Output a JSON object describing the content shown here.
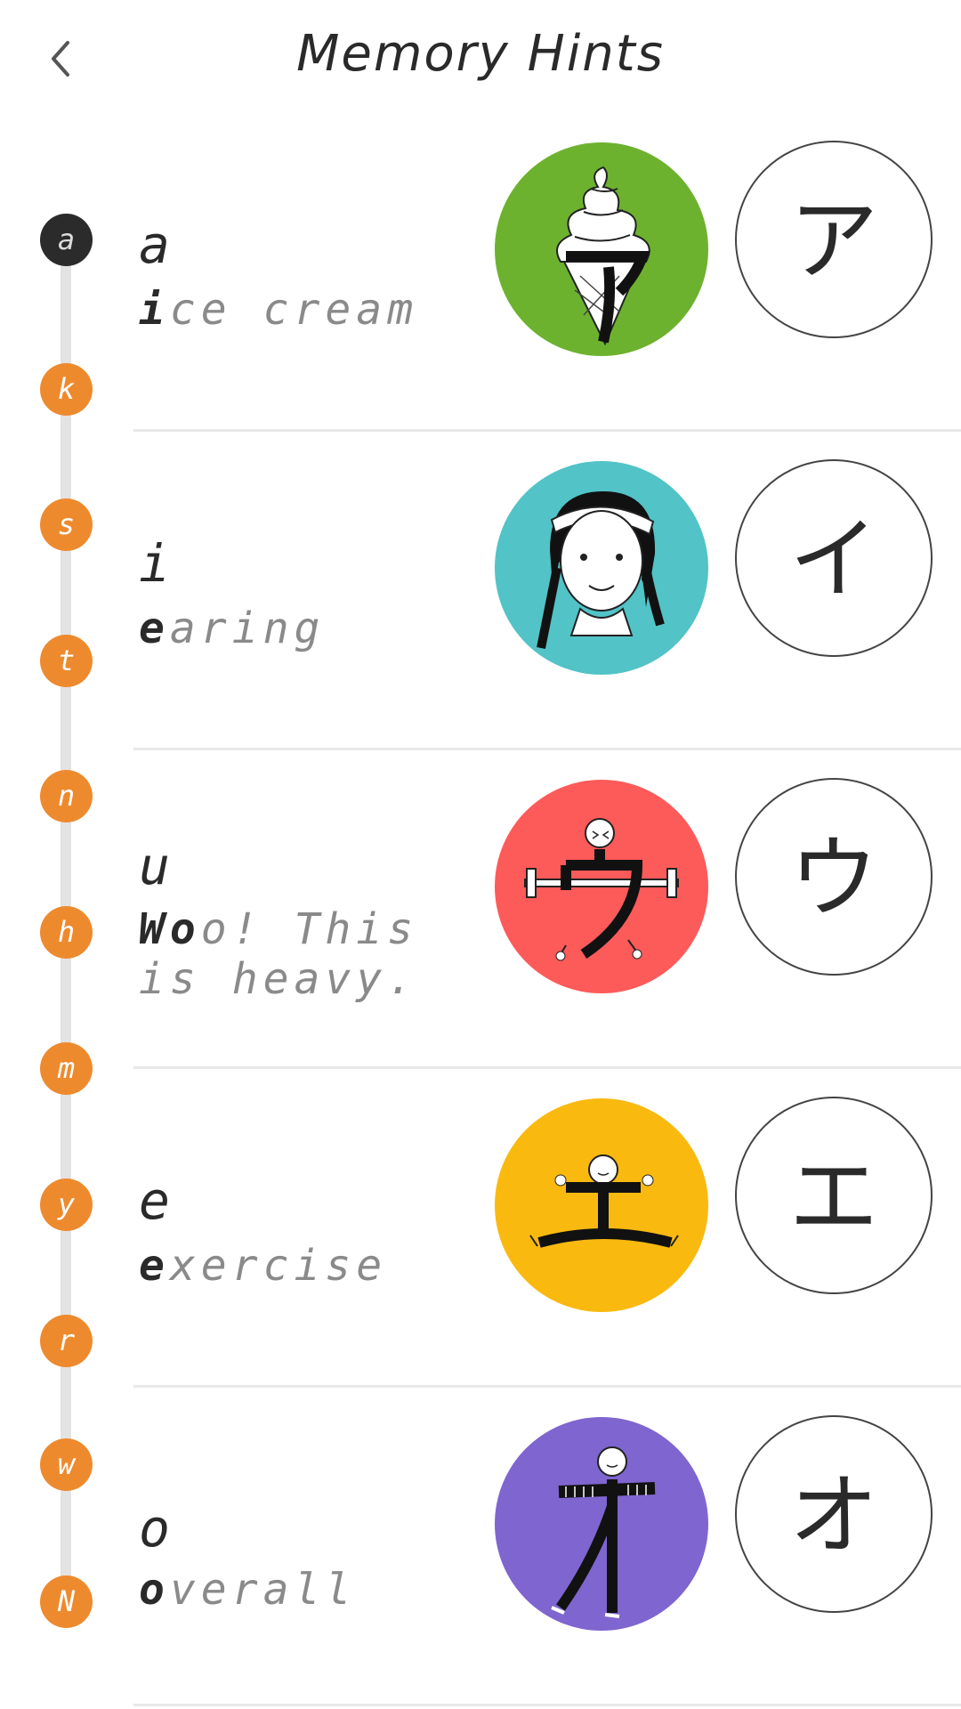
{
  "header": {
    "title": "Memory Hints",
    "back_icon": "chevron-left-icon"
  },
  "index": {
    "items": [
      {
        "label": "a",
        "active": true
      },
      {
        "label": "k",
        "active": false
      },
      {
        "label": "s",
        "active": false
      },
      {
        "label": "t",
        "active": false
      },
      {
        "label": "n",
        "active": false
      },
      {
        "label": "h",
        "active": false
      },
      {
        "label": "m",
        "active": false
      },
      {
        "label": "y",
        "active": false
      },
      {
        "label": "r",
        "active": false
      },
      {
        "label": "w",
        "active": false
      },
      {
        "label": "N",
        "active": false
      }
    ],
    "active_color": "#2b2b2b",
    "color": "#ee8a2e"
  },
  "hints": [
    {
      "romaji": "a",
      "mnemonic_highlight": "i",
      "mnemonic_rest": "ce cream",
      "kana": "ア",
      "image": "ice-cream-illustration",
      "image_color": "#6db22f"
    },
    {
      "romaji": "i",
      "mnemonic_highlight": "e",
      "mnemonic_rest": "aring",
      "kana": "イ",
      "image": "girl-with-earring-illustration",
      "image_color": "#52c3c7"
    },
    {
      "romaji": "u",
      "mnemonic_highlight": "Wo",
      "mnemonic_rest": "o! This is heavy.",
      "kana": "ウ",
      "image": "weightlifter-illustration",
      "image_color": "#fd5a5a"
    },
    {
      "romaji": "e",
      "mnemonic_highlight": "e",
      "mnemonic_rest": "xercise",
      "kana": "エ",
      "image": "exercise-illustration",
      "image_color": "#f9b90f"
    },
    {
      "romaji": "o",
      "mnemonic_highlight": "o",
      "mnemonic_rest": "verall",
      "kana": "オ",
      "image": "overall-figure-illustration",
      "image_color": "#7f65cf"
    }
  ]
}
